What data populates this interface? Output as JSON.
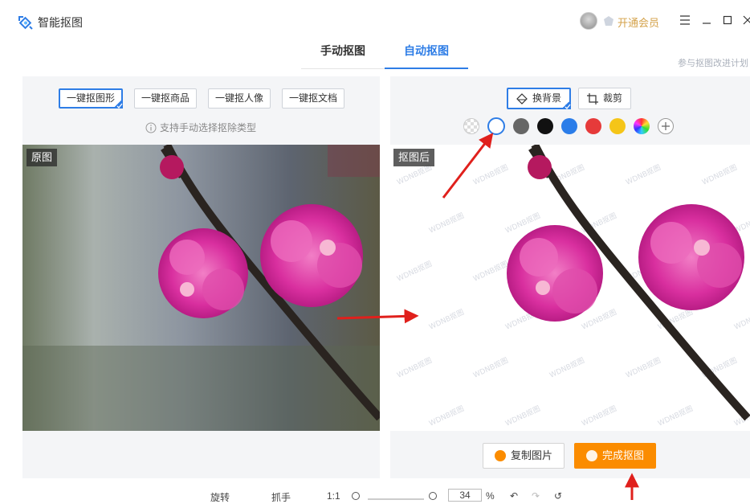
{
  "app": {
    "title": "智能抠图",
    "vip_label": "开通会员"
  },
  "tabs": [
    {
      "label": "手动抠图",
      "active": false
    },
    {
      "label": "自动抠图",
      "active": true
    }
  ],
  "plan_link": "参与抠图改进计划",
  "left_panel": {
    "modes": [
      {
        "label": "一键抠图形",
        "active": true
      },
      {
        "label": "一键抠商品",
        "active": false
      },
      {
        "label": "一键抠人像",
        "active": false
      },
      {
        "label": "一键抠文档",
        "active": false
      }
    ],
    "hint": "支持手动选择抠除类型",
    "image_tag": "原图"
  },
  "right_panel": {
    "tools": [
      {
        "label": "换背景",
        "active": true
      },
      {
        "label": "裁剪",
        "active": false
      }
    ],
    "swatches": [
      "transparent",
      "#ffffff",
      "#666666",
      "#111111",
      "#2b7de9",
      "#e63a3a",
      "#f5c518",
      "rainbow",
      "add"
    ],
    "selected_swatch": "#ffffff",
    "image_tag": "抠图后",
    "watermark": "WDNB抠图",
    "copy_button": "复制图片",
    "finish_button": "完成抠图"
  },
  "footer": {
    "rotate": "旋转",
    "hand": "抓手",
    "ratio": "1:1",
    "zoom": "34",
    "zoom_unit": "%"
  }
}
